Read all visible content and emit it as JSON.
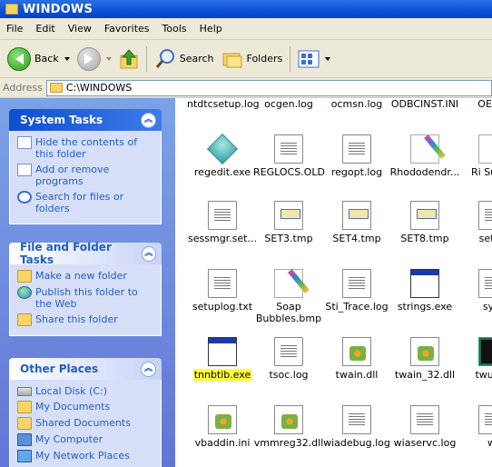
{
  "window": {
    "title": "WINDOWS"
  },
  "menu": [
    "File",
    "Edit",
    "View",
    "Favorites",
    "Tools",
    "Help"
  ],
  "toolbar": {
    "back": "Back",
    "search": "Search",
    "folders": "Folders"
  },
  "address": {
    "label": "Address",
    "path": "C:\\WINDOWS"
  },
  "sidebar": {
    "system_tasks": {
      "title": "System Tasks",
      "items": [
        "Hide the contents of this folder",
        "Add or remove programs",
        "Search for files or folders"
      ]
    },
    "file_folder_tasks": {
      "title": "File and Folder Tasks",
      "items": [
        "Make a new folder",
        "Publish this folder to the Web",
        "Share this folder"
      ]
    },
    "other_places": {
      "title": "Other Places",
      "items": [
        "Local Disk (C:)",
        "My Documents",
        "Shared Documents",
        "My Computer",
        "My Network Places"
      ]
    }
  },
  "files": {
    "row0": [
      "ntdtcsetup.log",
      "ocgen.log",
      "ocmsn.log",
      "ODBCINST.INI",
      "OEWA"
    ],
    "row1": [
      "regedit.exe",
      "REGLOCS.OLD",
      "regopt.log",
      "Rhododendr...",
      "Ri Sumic"
    ],
    "row2": [
      "sessmgr.set...",
      "SET3.tmp",
      "SET4.tmp",
      "SET8.tmp",
      "setup"
    ],
    "row3": [
      "setuplog.txt",
      "Soap Bubbles.bmp",
      "Sti_Trace.log",
      "strings.exe",
      "syst"
    ],
    "row4": [
      "tnnbtib.exe",
      "tsoc.log",
      "twain.dll",
      "twain_32.dll",
      "twunk_"
    ],
    "row5": [
      "vbaddin.ini",
      "vmmreg32.dll",
      "wiadebug.log",
      "wiaservc.log",
      "wi"
    ]
  },
  "highlight_color": "#ffff30"
}
